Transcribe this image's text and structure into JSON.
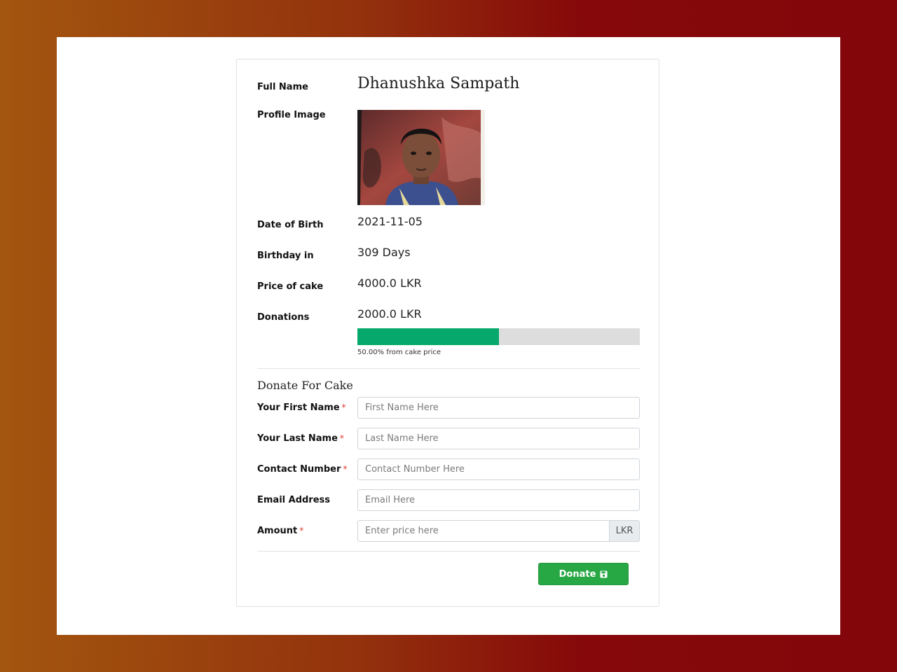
{
  "profile": {
    "full_name_label": "Full Name",
    "full_name": "Dhanushka Sampath",
    "profile_image_label": "Profile Image",
    "dob_label": "Date of Birth",
    "dob": "2021-11-05",
    "birthday_in_label": "Birthday in",
    "birthday_in": "309 Days",
    "price_label": "Price of cake",
    "price": "4000.0 LKR",
    "donations_label": "Donations",
    "donations": "2000.0 LKR",
    "progress_fraction": 0.5,
    "progress_note": "50.00% from cake price"
  },
  "form": {
    "title": "Donate For Cake",
    "required_mark": "*",
    "first_name_label": "Your First Name",
    "first_name_placeholder": "First Name Here",
    "last_name_label": "Your Last Name",
    "last_name_placeholder": "Last Name Here",
    "contact_label": "Contact Number",
    "contact_placeholder": "Contact Number Here",
    "email_label": "Email Address",
    "email_placeholder": "Email Here",
    "amount_label": "Amount",
    "amount_placeholder": "Enter price here",
    "amount_currency": "LKR",
    "donate_label": "Donate"
  },
  "colors": {
    "progress": "#06a96b",
    "donate_button": "#28a745",
    "required": "#e0352b"
  },
  "icons": {
    "donate_button_icon": "save-icon"
  }
}
